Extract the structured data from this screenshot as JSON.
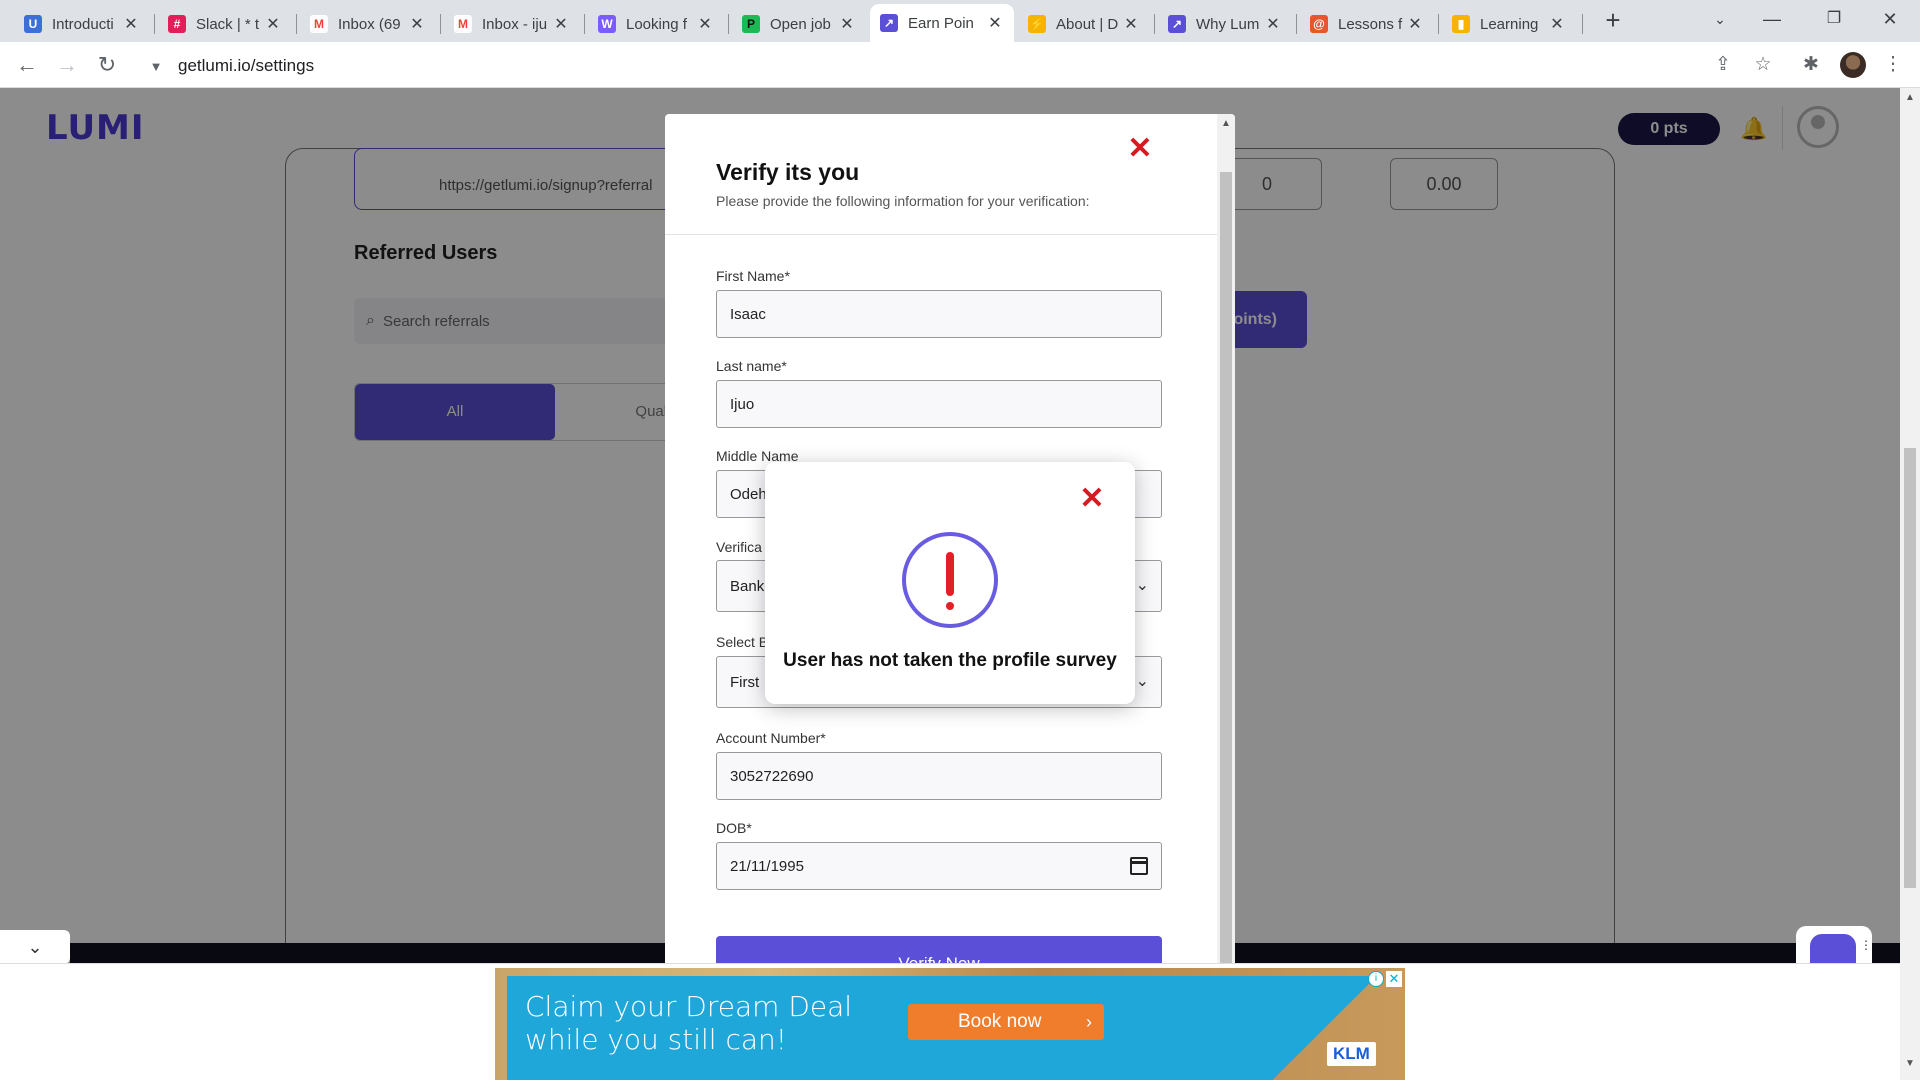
{
  "browser": {
    "tabs": [
      {
        "title": "Introducti",
        "icon": "u-logo-icon",
        "color": "#3d6fd8"
      },
      {
        "title": "Slack | * t",
        "icon": "slack-icon",
        "color": "#e01e5a"
      },
      {
        "title": "Inbox (69",
        "icon": "gmail-icon",
        "color": "#ea4335"
      },
      {
        "title": "Inbox - iju",
        "icon": "gmail-icon",
        "color": "#ea4335"
      },
      {
        "title": "Looking f",
        "icon": "w-logo-icon",
        "color": "#7b5cff"
      },
      {
        "title": "Open job",
        "icon": "pc-logo-icon",
        "color": "#1db954"
      },
      {
        "title": "Earn Poin",
        "icon": "lumi-logo-icon",
        "color": "#5a4fd6"
      },
      {
        "title": "About | D",
        "icon": "bolt-icon",
        "color": "#f4b400"
      },
      {
        "title": "Why Lum",
        "icon": "lumi-logo-icon",
        "color": "#5a4fd6"
      },
      {
        "title": "Lessons f",
        "icon": "swirl-icon",
        "color": "#e8562e"
      },
      {
        "title": "Learning",
        "icon": "bars-icon",
        "color": "#f4b400"
      }
    ],
    "active_tab_index": 6,
    "url": "getlumi.io/settings"
  },
  "site": {
    "logo": "LUMI",
    "points_pill": "0 pts",
    "referral_link": "https://getlumi.io/signup?referral",
    "stat_values": [
      "0",
      "0.00"
    ],
    "referred_title": "Referred Users",
    "search_placeholder": "Search referrals",
    "points_button_fragment": "oints)",
    "filter_tabs": [
      "All",
      "Qualif"
    ]
  },
  "modal": {
    "title": "Verify its you",
    "subtitle": "Please provide the following information for your verification:",
    "first_name_label": "First Name*",
    "first_name_value": "Isaac",
    "last_name_label": "Last name*",
    "last_name_value": "Ijuo",
    "middle_name_label": "Middle Name",
    "middle_name_value": "Odeh",
    "verification_label": "Verifica",
    "verification_value": "Bank",
    "select_bank_label": "Select B",
    "select_bank_value": "First",
    "account_number_label": "Account Number*",
    "account_number_value": "3052722690",
    "dob_label": "DOB*",
    "dob_value": "21/11/1995",
    "verify_button": "Verify Now"
  },
  "alert": {
    "message": "User has not taken the profile survey"
  },
  "ad": {
    "headline": "Claim your Dream Deal while you still can!",
    "cta": "Book now",
    "brand": "KLM"
  },
  "colors": {
    "accent": "#5a4fd6",
    "close_red": "#d71920",
    "alert_mark": "#e21e26"
  }
}
